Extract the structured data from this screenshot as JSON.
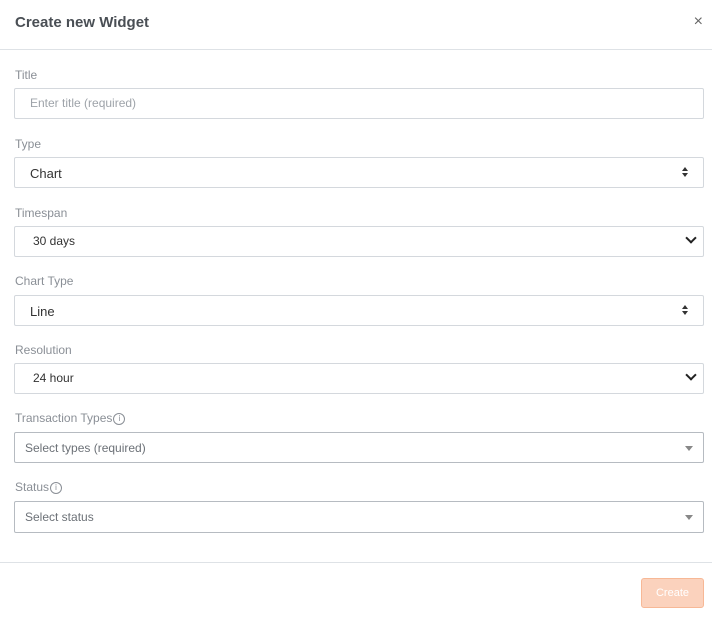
{
  "header": {
    "title": "Create new Widget",
    "close_label": "×"
  },
  "form": {
    "title": {
      "label": "Title",
      "placeholder": "Enter title (required)"
    },
    "type": {
      "label": "Type",
      "value": "Chart"
    },
    "timespan": {
      "label": "Timespan",
      "value": "30 days"
    },
    "chart_type": {
      "label": "Chart Type",
      "value": "Line"
    },
    "resolution": {
      "label": "Resolution",
      "value": "24 hour"
    },
    "transaction_types": {
      "label": "Transaction Types",
      "placeholder": "Select types (required)",
      "info": "i"
    },
    "status": {
      "label": "Status",
      "placeholder": "Select status",
      "info": "i"
    }
  },
  "footer": {
    "create_label": "Create"
  },
  "colors": {
    "accent": "#fbd2bd",
    "border": "#d4d8dd",
    "label": "#8a8f96"
  }
}
